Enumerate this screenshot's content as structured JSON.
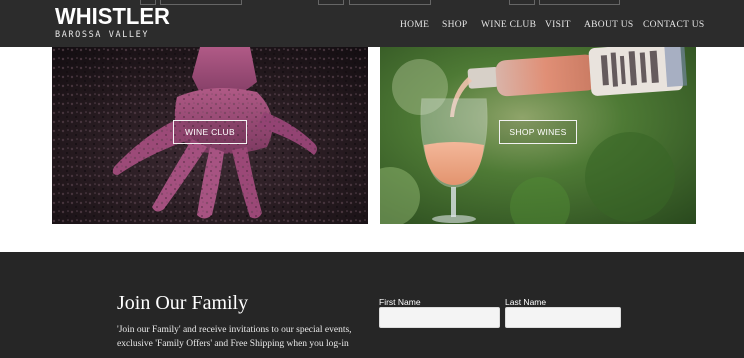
{
  "brand": {
    "name": "WHISTLER",
    "subtitle": "BAROSSA VALLEY"
  },
  "nav": {
    "items": [
      "HOME",
      "SHOP",
      "WINE CLUB",
      "VISIT",
      "ABOUT US",
      "CONTACT US"
    ]
  },
  "tiles": {
    "left": {
      "button_label": "WINE CLUB",
      "image": "hand-in-grape-pomace"
    },
    "right": {
      "button_label": "SHOP WINES",
      "image": "rose-wine-pouring-into-glass"
    }
  },
  "footer": {
    "title": "Join Our Family",
    "text": "'Join our Family' and receive invitations to our special events, exclusive 'Family Offers' and Free Shipping when you log-in",
    "first_name_label": "First Name",
    "last_name_label": "Last Name",
    "first_name_value": "",
    "last_name_value": ""
  },
  "colors": {
    "header_bg": "#2c2c2c",
    "footer_bg": "#262626",
    "page_bg": "#ffffff"
  }
}
